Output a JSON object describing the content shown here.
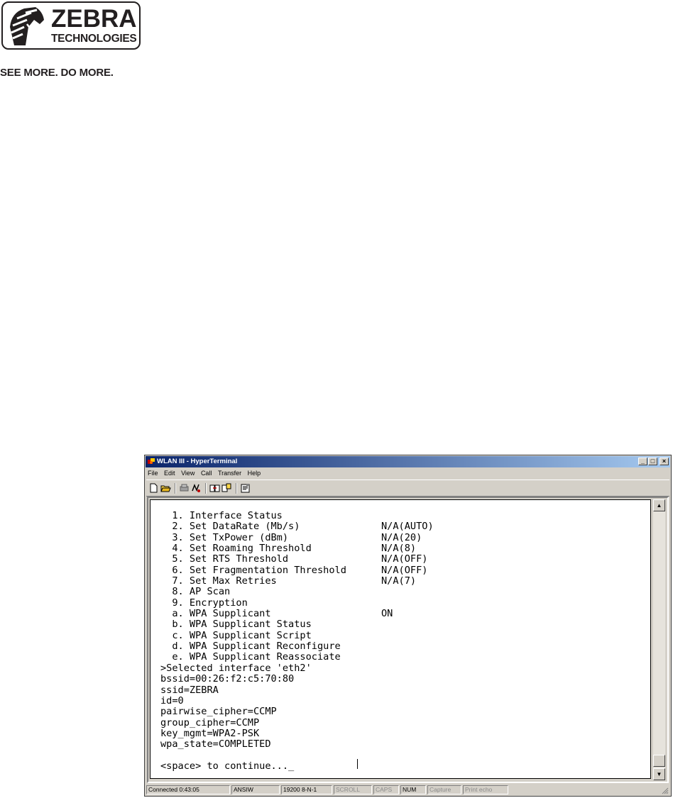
{
  "logo": {
    "word": "ZEBRA",
    "sub": "TECHNOLOGIES",
    "tagline": "SEE MORE. DO MORE."
  },
  "window": {
    "title": "WLAN III - HyperTerminal",
    "menu": [
      "File",
      "Edit",
      "View",
      "Call",
      "Transfer",
      "Help"
    ],
    "toolbar_icons": [
      "new-icon",
      "open-icon",
      "disconnect-icon",
      "dial-icon",
      "send-icon",
      "receive-icon",
      "properties-icon"
    ]
  },
  "terminal": {
    "lines": [
      "  1. Interface Status",
      "  2. Set DataRate (Mb/s)              N/A(AUTO)",
      "  3. Set TxPower (dBm)                N/A(20)",
      "  4. Set Roaming Threshold            N/A(8)",
      "  5. Set RTS Threshold                N/A(OFF)",
      "  6. Set Fragmentation Threshold      N/A(OFF)",
      "  7. Set Max Retries                  N/A(7)",
      "  8. AP Scan",
      "  9. Encryption",
      "  a. WPA Supplicant                   ON",
      "  b. WPA Supplicant Status",
      "  c. WPA Supplicant Script",
      "  d. WPA Supplicant Reconfigure",
      "  e. WPA Supplicant Reassociate",
      ">Selected interface 'eth2'",
      "bssid=00:26:f2:c5:70:80",
      "ssid=ZEBRA",
      "id=0",
      "pairwise_cipher=CCMP",
      "group_cipher=CCMP",
      "key_mgmt=WPA2-PSK",
      "wpa_state=COMPLETED",
      "",
      "<space> to continue..._"
    ]
  },
  "status": {
    "connected": "Connected 0:43:05",
    "emulation": "ANSIW",
    "port": "19200 8-N-1",
    "scroll": "SCROLL",
    "caps": "CAPS",
    "num": "NUM",
    "capture": "Capture",
    "print_echo": "Print echo"
  }
}
